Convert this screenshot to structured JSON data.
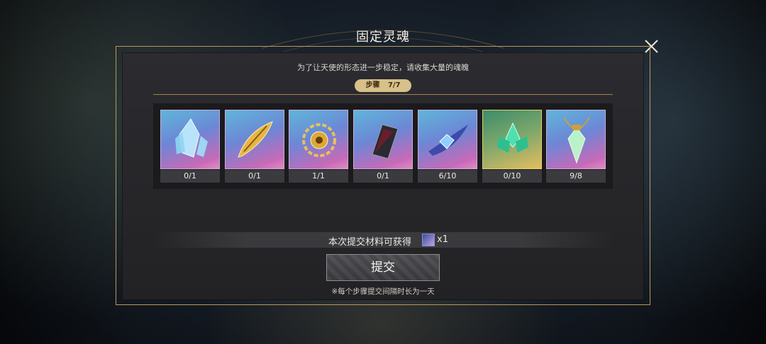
{
  "dialog": {
    "title": "固定灵魂",
    "subtitle": "为了让天使的形态进一步稳定，请收集大量的魂魄",
    "step": {
      "label": "步骤",
      "value": "7/7"
    },
    "close_icon": "close-icon"
  },
  "items": [
    {
      "icon": "crystal-cluster-icon",
      "count": "0/1",
      "frame": "pink"
    },
    {
      "icon": "golden-feather-icon",
      "count": "0/1",
      "frame": "pink"
    },
    {
      "icon": "golden-flower-icon",
      "count": "1/1",
      "frame": "pink"
    },
    {
      "icon": "dark-book-icon",
      "count": "0/1",
      "frame": "pink"
    },
    {
      "icon": "blue-gem-icon",
      "count": "6/10",
      "frame": "pink"
    },
    {
      "icon": "green-lotus-icon",
      "count": "0/10",
      "frame": "gold"
    },
    {
      "icon": "green-pendant-icon",
      "count": "9/8",
      "frame": "pink"
    }
  ],
  "reward": {
    "text": "本次提交材料可获得",
    "icon": "soul-card-icon",
    "quantity": "x1"
  },
  "submit": {
    "label": "提交"
  },
  "note": "※每个步骤提交间隔时长为一天",
  "colors": {
    "accent_gold": "#b9985a",
    "badge_bg": "#d7c089",
    "panel_bg": "#2b2b30"
  }
}
